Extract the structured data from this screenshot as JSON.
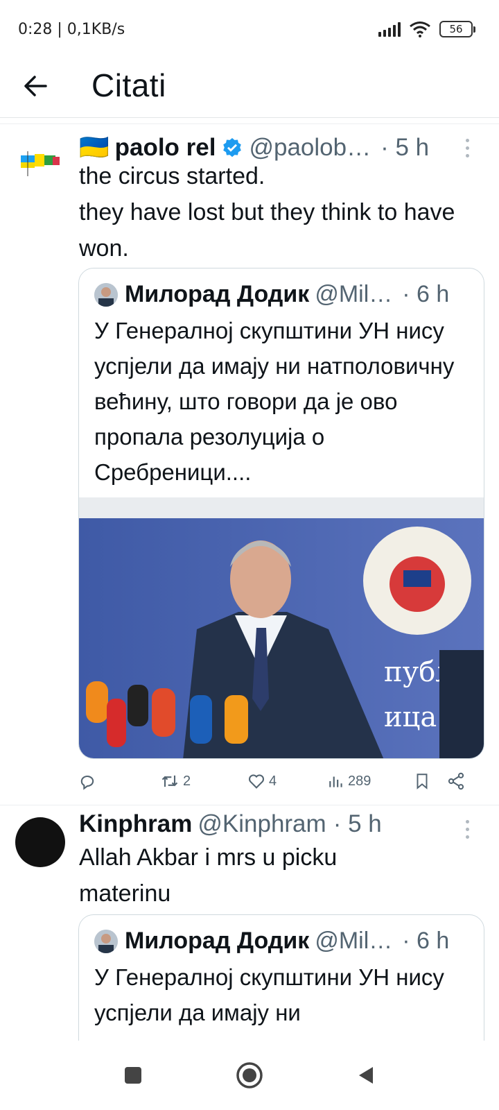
{
  "status_bar": {
    "time": "0:28 | 0,1KB/s",
    "battery": "56"
  },
  "header": {
    "title": "Citati"
  },
  "tweets": [
    {
      "flag": "🇺🇦",
      "name": "paolo rel",
      "verified": true,
      "handle": "@paolob…",
      "time": "· 5 h",
      "text": "the circus started.\nthey have lost but they think to have won.",
      "quote": {
        "name": "Милорад Додик",
        "handle": "@Mil…",
        "time": "· 6 h",
        "text": "У Генералној скупштини УН нису успјели да имају ни натполовичну већину, што говори да је ово пропала резолуција о Сребреници...."
      },
      "actions": {
        "retweets": "2",
        "likes": "4",
        "views": "289"
      }
    },
    {
      "name": "Kinphram",
      "handle": "@Kinphram",
      "time": "· 5 h",
      "text": "Allah Akbar i mrs u picku materinu",
      "quote": {
        "name": "Милорад Додик",
        "handle": "@Mil…",
        "time": "· 6 h",
        "text": "У Генералној скупштини УН нису успјели да имају ни"
      }
    }
  ],
  "colors": {
    "verified": "#1d9bf0",
    "secondary": "#536471"
  },
  "icons": [
    "back-arrow-icon",
    "verified-icon",
    "more-icon",
    "reply-icon",
    "retweet-icon",
    "like-icon",
    "views-icon",
    "bookmark-icon",
    "share-icon",
    "nav-recents-icon",
    "nav-home-icon",
    "nav-back-icon"
  ]
}
